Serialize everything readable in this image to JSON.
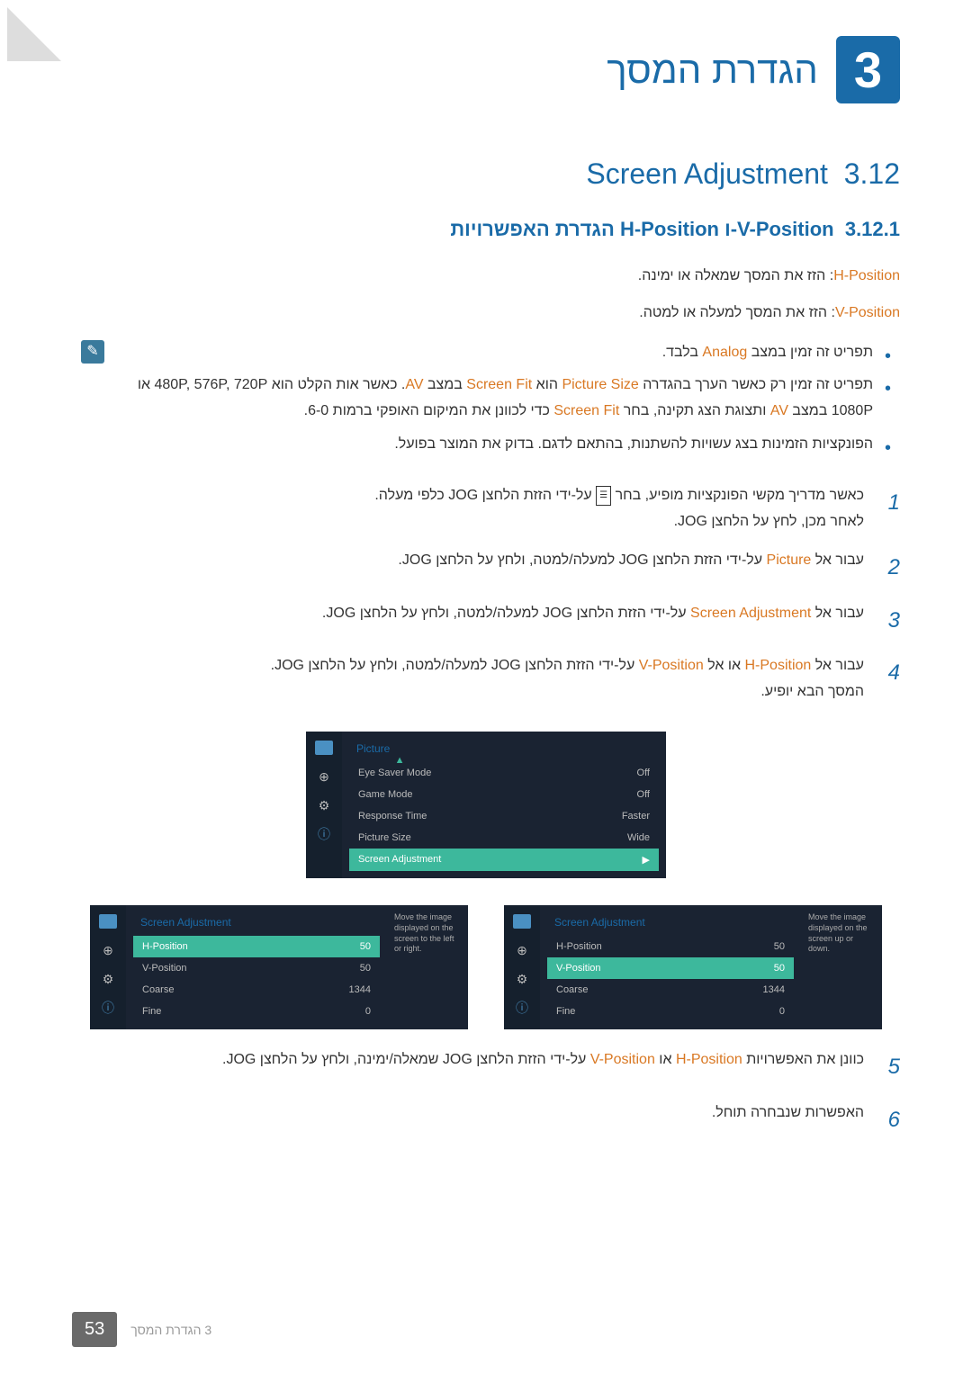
{
  "chapter": {
    "num": "3",
    "title": "הגדרת המסך"
  },
  "section": {
    "num": "3.12",
    "title": "Screen Adjustment"
  },
  "subsection": {
    "num": "3.12.1",
    "title": "הגדרת האפשרויות H-Position ו-V-Position"
  },
  "hpos": {
    "label": "H-Position",
    "desc": ": הזז את המסך שמאלה או ימינה."
  },
  "vpos": {
    "label": "V-Position",
    "desc": ": הזז את המסך למעלה או למטה."
  },
  "notes": {
    "n1a": "תפריט זה זמין במצב ",
    "n1b": "Analog",
    "n1c": " בלבד.",
    "n2a": "תפריט זה זמין רק כאשר הערך בהגדרה ",
    "n2b": "Picture Size",
    "n2c": " הוא ",
    "n2d": "Screen Fit",
    "n2e": " במצב ",
    "n2f": "AV",
    "n2g": ". כאשר אות הקלט הוא 480P, 576P, 720P או 1080P במצב ",
    "n2h": "AV",
    "n2i": " ותצוגת הצג תקינה, בחר ",
    "n2j": "Screen Fit",
    "n2k": " כדי לכוונן את המיקום האופקי ברמות 6-0.",
    "n3": "הפונקציות הזמינות בצג עשויות להשתנות, בהתאם לדגם. בדוק את המוצר בפועל."
  },
  "steps": {
    "s1a": "כאשר מדריך מקשי הפונקציות מופיע, בחר ",
    "s1b": " על-ידי הזזת הלחצן JOG כלפי מעלה.",
    "s1c": "לאחר מכן, לחץ על הלחצן JOG.",
    "s2a": "עבור אל ",
    "s2b": "Picture",
    "s2c": " על-ידי הזזת הלחצן JOG למעלה/למטה, ולחץ על הלחצן JOG.",
    "s3a": "עבור אל ",
    "s3b": "Screen Adjustment",
    "s3c": " על-ידי הזזת הלחצן JOG למעלה/למטה, ולחץ על הלחצן JOG.",
    "s4a": "עבור אל ",
    "s4b": "H-Position",
    "s4c": " או אל ",
    "s4d": "V-Position",
    "s4e": " על-ידי הזזת הלחצן JOG למעלה/למטה, ולחץ על הלחצן JOG.",
    "s4f": "המסך הבא יופיע.",
    "s5a": "כוונן את האפשרויות ",
    "s5b": "H-Position",
    "s5c": " או ",
    "s5d": "V-Position",
    "s5e": " על-ידי הזזת הלחצן JOG שמאלה/ימינה, ולחץ על הלחצן JOG.",
    "s6": "האפשרות שנבחרה תוחל."
  },
  "nums": {
    "n1": "1",
    "n2": "2",
    "n3": "3",
    "n4": "4",
    "n5": "5",
    "n6": "6"
  },
  "osd1": {
    "title": "Picture",
    "r1": {
      "l": "Eye Saver Mode",
      "v": "Off"
    },
    "r2": {
      "l": "Game Mode",
      "v": "Off"
    },
    "r3": {
      "l": "Response Time",
      "v": "Faster"
    },
    "r4": {
      "l": "Picture Size",
      "v": "Wide"
    },
    "r5": {
      "l": "Screen Adjustment",
      "v": "▶"
    }
  },
  "osd2": {
    "title": "Screen Adjustment",
    "r1": {
      "l": "H-Position",
      "v": "50"
    },
    "r2": {
      "l": "V-Position",
      "v": "50"
    },
    "r3": {
      "l": "Coarse",
      "v": "1344"
    },
    "r4": {
      "l": "Fine",
      "v": "0"
    },
    "desc": "Move the image displayed on the screen to the left or right."
  },
  "osd3": {
    "title": "Screen Adjustment",
    "r1": {
      "l": "H-Position",
      "v": "50"
    },
    "r2": {
      "l": "V-Position",
      "v": "50"
    },
    "r3": {
      "l": "Coarse",
      "v": "1344"
    },
    "r4": {
      "l": "Fine",
      "v": "0"
    },
    "desc": "Move the image displayed on the screen up or down."
  },
  "footer": {
    "text": "3 הגדרת המסך",
    "page": "53"
  }
}
